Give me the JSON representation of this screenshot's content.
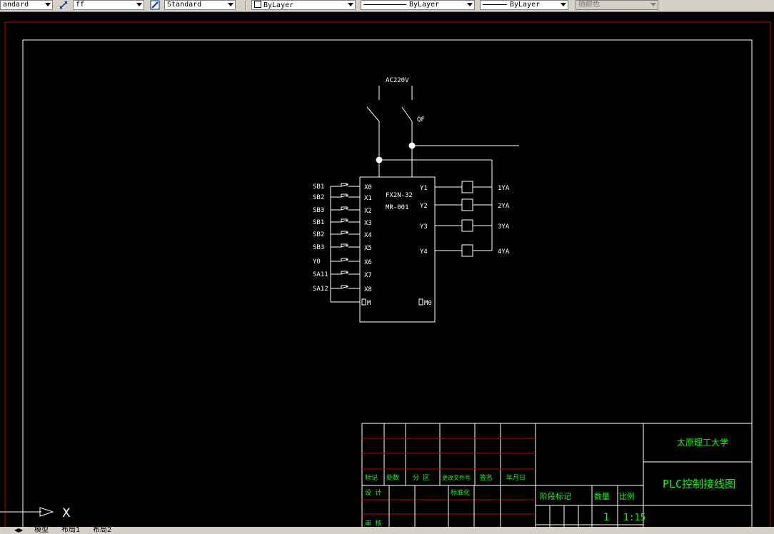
{
  "toolbar": {
    "text_style": "andard",
    "dim_scale": "ff",
    "dim_style": "Standard",
    "layer": "ByLayer",
    "linetype": "ByLayer",
    "lineweight": "ByLayer",
    "plot_style": "随颜色"
  },
  "drawing": {
    "supply_label": "AC220V",
    "breaker_label": "QF",
    "plc_model_line1": "FX2N-32",
    "plc_model_line2": "MR-001",
    "inputs": [
      {
        "label": "SB1",
        "terminal": "X0"
      },
      {
        "label": "SB2",
        "terminal": "X1"
      },
      {
        "label": "SB3",
        "terminal": "X2"
      },
      {
        "label": "SB1",
        "terminal": "X3"
      },
      {
        "label": "SB2",
        "terminal": "X4"
      },
      {
        "label": "SB3",
        "terminal": "X5"
      },
      {
        "label": "Y0",
        "terminal": "X6"
      },
      {
        "label": "SA11",
        "terminal": "X7"
      },
      {
        "label": "SA12",
        "terminal": "X8"
      }
    ],
    "com_left": "M",
    "com_right": "M0",
    "outputs": [
      {
        "terminal": "Y1",
        "load": "1YA"
      },
      {
        "terminal": "Y2",
        "load": "2YA"
      },
      {
        "terminal": "Y3",
        "load": "3YA"
      },
      {
        "terminal": "Y4",
        "load": "4YA"
      }
    ]
  },
  "title_block": {
    "university": "太原理工大学",
    "title": "PLC控制接线图",
    "rev_headers": [
      "标记",
      "处数",
      "分 区",
      "更改文件号",
      "签名",
      "年月日"
    ],
    "design_label": "设 计",
    "standard_label": "标准化",
    "review_label": "审 核",
    "stage_mark_label": "阶段标记",
    "quantity_label": "数量",
    "scale_label": "比例",
    "quantity_value": "1",
    "scale_value": "1:15"
  },
  "ucs_icon": {
    "axis_label": "X"
  },
  "tabs": [
    "模型",
    "布局1",
    "布局2"
  ]
}
